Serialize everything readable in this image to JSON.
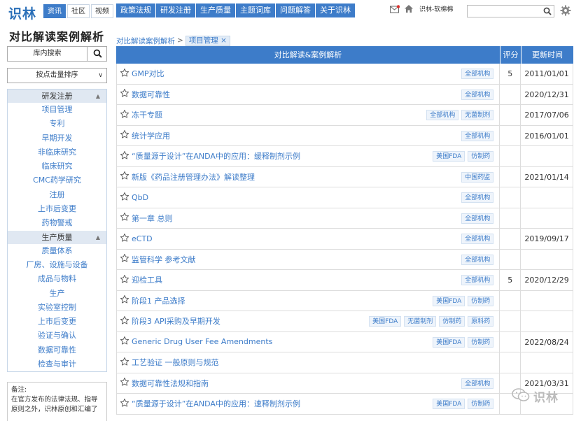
{
  "header": {
    "logo": "识林",
    "tabs": [
      "资讯",
      "社区",
      "视频"
    ],
    "active_tab": 0,
    "nav": [
      "政策法规",
      "研发注册",
      "生产质量",
      "主题词库",
      "问题解答",
      "关于识林"
    ],
    "user": "识林-软棉棉",
    "search_placeholder": ""
  },
  "sidebar": {
    "title": "对比解读案例解析",
    "search_label": "库内搜索",
    "sort_label": "按点击量排序",
    "categories": [
      {
        "name": "研发注册",
        "items": [
          "项目管理",
          "专利",
          "早期开发",
          "非临床研究",
          "临床研究",
          "CMC药学研究",
          "注册",
          "上市后变更",
          "药物警戒"
        ]
      },
      {
        "name": "生产质量",
        "items": [
          "质量体系",
          "厂房、设施与设备",
          "成品与物料",
          "生产",
          "实验室控制",
          "上市后变更",
          "验证与确认",
          "数据可靠性",
          "检查与审计"
        ]
      }
    ],
    "note_lines": [
      "备注:",
      "在官方发布的法律法规、指导",
      "原则之外，识林原创和汇编了"
    ]
  },
  "breadcrumb": {
    "parent": "对比解读案例解析",
    "separator": ">",
    "current": "项目管理 ×"
  },
  "table": {
    "headers": [
      "对比解读&案例解析",
      "评分",
      "更新时间"
    ],
    "rows": [
      {
        "title": "GMP对比",
        "tags": [
          "全部机构"
        ],
        "score": "5",
        "date": "2011/01/01"
      },
      {
        "title": "数据可靠性",
        "tags": [
          "全部机构"
        ],
        "score": "",
        "date": "2020/12/31"
      },
      {
        "title": "冻干专题",
        "tags": [
          "全部机构",
          "无菌制剂"
        ],
        "score": "",
        "date": "2017/07/06"
      },
      {
        "title": "统计学应用",
        "tags": [
          "全部机构"
        ],
        "score": "",
        "date": "2016/01/01"
      },
      {
        "title": "“质量源于设计”在ANDA中的应用：缓释制剂示例",
        "tags": [
          "美国FDA",
          "仿制药"
        ],
        "score": "",
        "date": ""
      },
      {
        "title": "新版《药品注册管理办法》解读整理",
        "tags": [
          "中国药监"
        ],
        "score": "",
        "date": "2021/01/14"
      },
      {
        "title": "QbD",
        "tags": [
          "全部机构"
        ],
        "score": "",
        "date": ""
      },
      {
        "title": "第一章 总则",
        "tags": [
          "全部机构"
        ],
        "score": "",
        "date": ""
      },
      {
        "title": "eCTD",
        "tags": [
          "全部机构"
        ],
        "score": "",
        "date": "2019/09/17"
      },
      {
        "title": "监管科学 参考文献",
        "tags": [
          "全部机构"
        ],
        "score": "",
        "date": ""
      },
      {
        "title": "迎检工具",
        "tags": [
          "全部机构"
        ],
        "score": "5",
        "date": "2020/12/29"
      },
      {
        "title": "阶段1 产品选择",
        "tags": [
          "美国FDA",
          "仿制药"
        ],
        "score": "",
        "date": ""
      },
      {
        "title": "阶段3 API采购及早期开发",
        "tags": [
          "美国FDA",
          "无菌制剂",
          "仿制药",
          "原料药"
        ],
        "score": "",
        "date": ""
      },
      {
        "title": "Generic Drug User Fee Amendments",
        "tags": [
          "美国FDA",
          "仿制药"
        ],
        "score": "",
        "date": "2022/08/24"
      },
      {
        "title": "工艺验证 一般原则与规范",
        "tags": [],
        "score": "",
        "date": ""
      },
      {
        "title": "数据可靠性法规和指南",
        "tags": [
          "全部机构"
        ],
        "score": "",
        "date": "2021/03/31"
      },
      {
        "title": "“质量源于设计”在ANDA中的应用：速释制剂示例",
        "tags": [
          "美国FDA",
          "仿制药"
        ],
        "score": "",
        "date": ""
      }
    ]
  },
  "watermark": "识林",
  "colors": {
    "accent": "#3d7cc9",
    "category_bg": "#e0e8f2",
    "tag_bg": "#eef4fb"
  }
}
